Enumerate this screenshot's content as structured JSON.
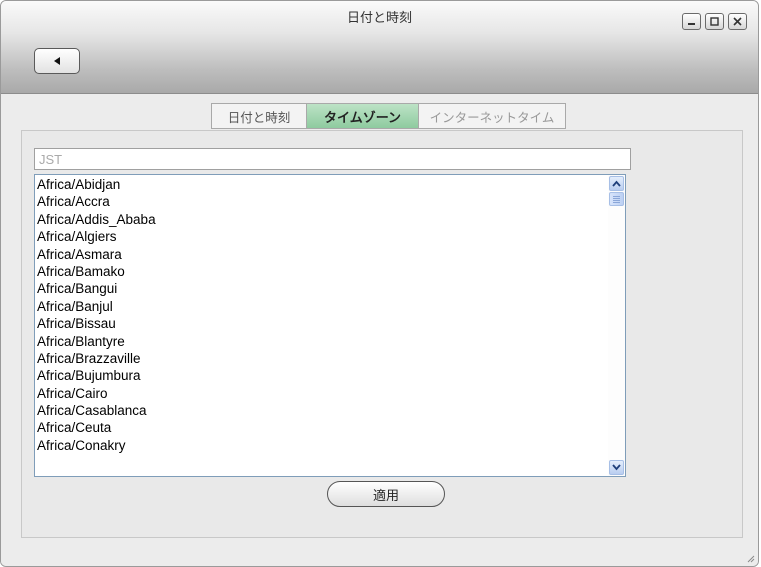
{
  "window": {
    "title": "日付と時刻"
  },
  "icons": {
    "back": "left-triangle-icon",
    "minimize": "minimize-icon",
    "maximize": "maximize-icon",
    "close": "close-icon",
    "scroll_up": "chevron-up-icon",
    "scroll_down": "chevron-down-icon"
  },
  "tabs": [
    {
      "label": "日付と時刻",
      "active": false
    },
    {
      "label": "タイムゾーン",
      "active": true
    },
    {
      "label": "インターネットタイム",
      "active": false
    }
  ],
  "timezone": {
    "search_value": "JST",
    "items": [
      "Africa/Abidjan",
      "Africa/Accra",
      "Africa/Addis_Ababa",
      "Africa/Algiers",
      "Africa/Asmara",
      "Africa/Bamako",
      "Africa/Bangui",
      "Africa/Banjul",
      "Africa/Bissau",
      "Africa/Blantyre",
      "Africa/Brazzaville",
      "Africa/Bujumbura",
      "Africa/Cairo",
      "Africa/Casablanca",
      "Africa/Ceuta",
      "Africa/Conakry"
    ]
  },
  "apply_label": "適用",
  "colors": {
    "active_tab": "#9fd4ad",
    "list_border": "#7f9db9",
    "scrollbar": "#b9cdf0"
  }
}
